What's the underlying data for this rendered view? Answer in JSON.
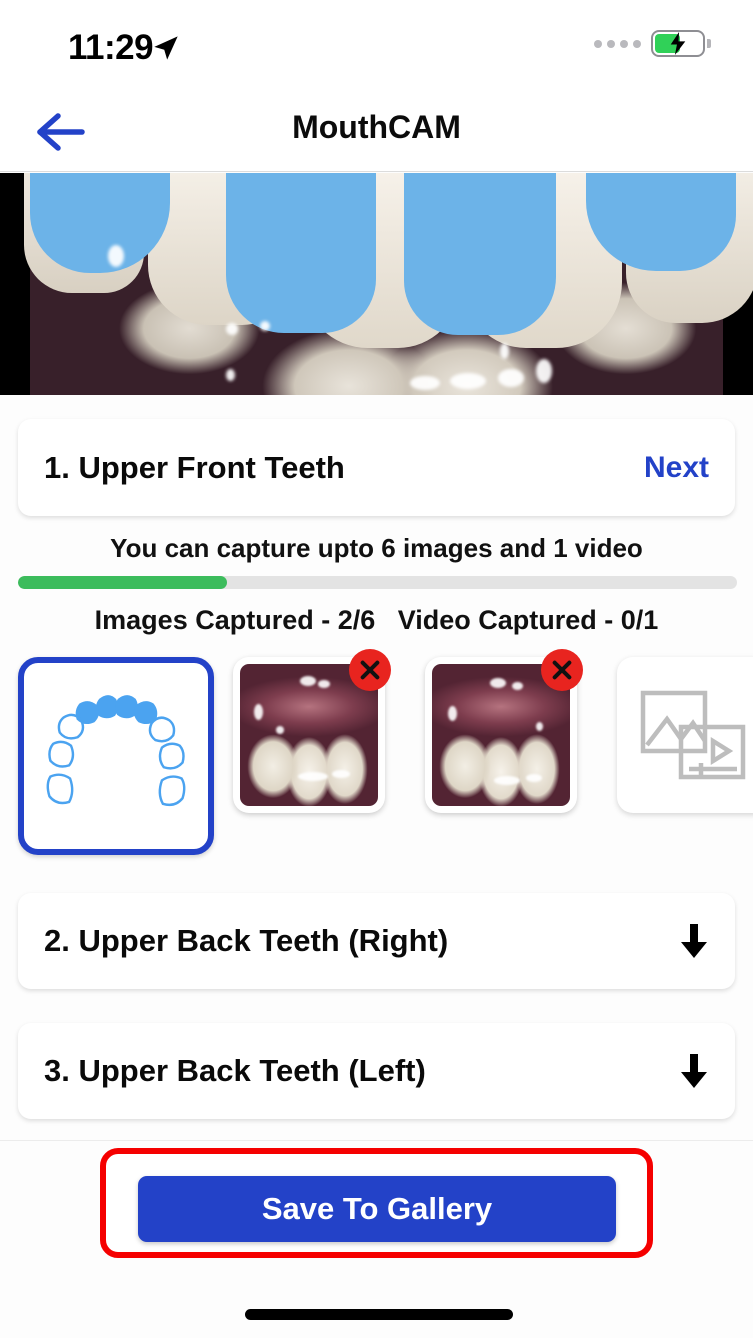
{
  "status_bar": {
    "time": "11:29",
    "location_icon": "location-arrow-icon",
    "signal_icon": "signal-dots-icon",
    "battery_icon": "battery-charging-icon",
    "battery_level_pct": 55
  },
  "nav": {
    "back_icon": "back-arrow-icon",
    "title": "MouthCAM"
  },
  "preview": {
    "name": "camera-preview",
    "description": "Intraoral camera live view of upper front teeth with blue target overlay"
  },
  "sections": [
    {
      "title": "1. Upper Front Teeth",
      "action_label": "Next",
      "expanded": true
    },
    {
      "title": "2. Upper Back Teeth (Right)",
      "action_icon": "down-arrow-icon",
      "expanded": false
    },
    {
      "title": "3. Upper Back Teeth (Left)",
      "action_icon": "down-arrow-icon",
      "expanded": false
    }
  ],
  "capture": {
    "hint": "You can capture upto 6 images and 1 video",
    "progress_pct": 29,
    "images_label": "Images Captured - 2/6",
    "video_label": "Video Captured - 0/1",
    "images_captured": 2,
    "images_max": 6,
    "videos_captured": 0,
    "videos_max": 1
  },
  "thumbnails": [
    {
      "type": "arch-diagram",
      "name": "upper-front-teeth-arch-icon",
      "selected": true,
      "deletable": false
    },
    {
      "type": "photo",
      "name": "captured-photo-1",
      "selected": false,
      "deletable": true,
      "delete_icon": "delete-x-icon"
    },
    {
      "type": "photo",
      "name": "captured-photo-2",
      "selected": false,
      "deletable": true,
      "delete_icon": "delete-x-icon"
    },
    {
      "type": "video-placeholder",
      "name": "video-placeholder-icon",
      "selected": false,
      "deletable": false
    }
  ],
  "save": {
    "label": "Save To Gallery",
    "highlighted": true
  },
  "colors": {
    "accent_blue": "#2342C8",
    "tooth_highlight_blue": "#6CB3E8",
    "progress_green": "#3CBC5C",
    "delete_red": "#E8241F",
    "annotation_red": "#F50000"
  }
}
